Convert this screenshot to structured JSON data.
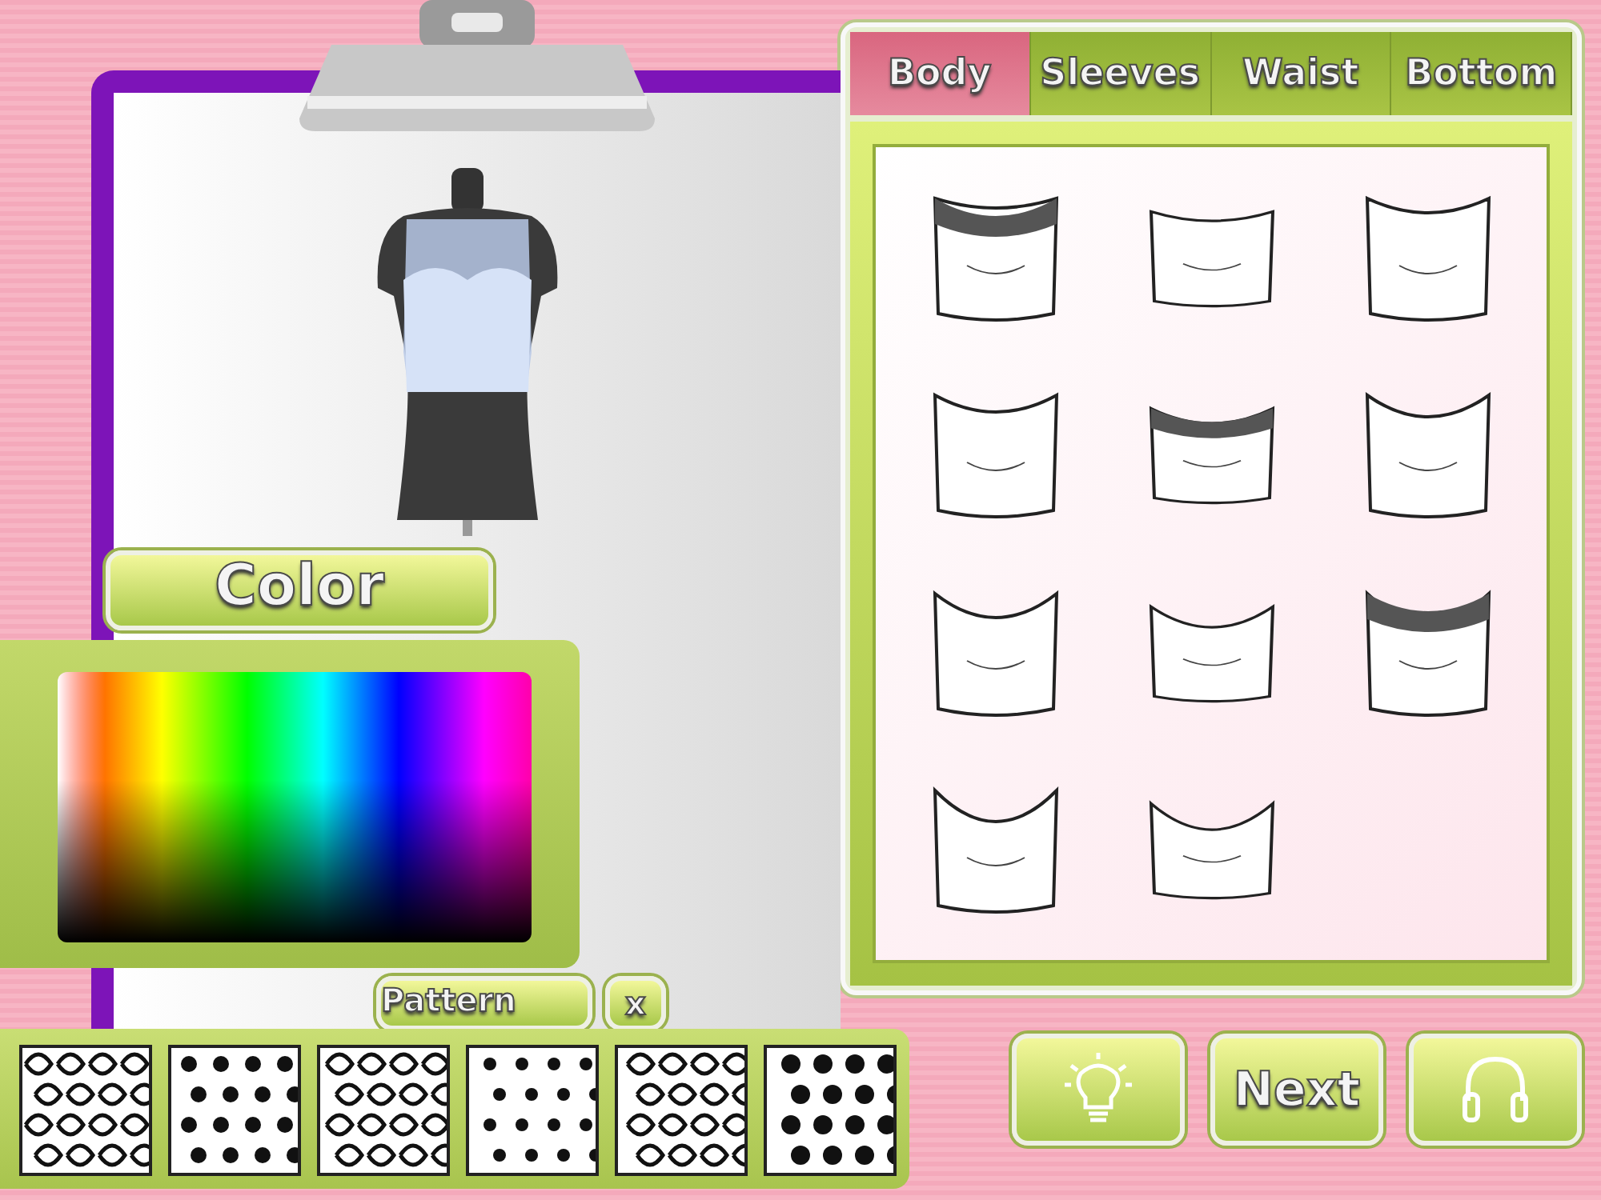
{
  "color_panel": {
    "title": "Color"
  },
  "pattern_panel": {
    "title": "Pattern",
    "close": "x"
  },
  "tabs": [
    {
      "label": "Body",
      "selected": true
    },
    {
      "label": "Sleeves",
      "selected": false
    },
    {
      "label": "Waist",
      "selected": false
    },
    {
      "label": "Bottom",
      "selected": false
    }
  ],
  "buttons": [
    {
      "kind": "hint"
    },
    {
      "kind": "text",
      "label": "Next"
    },
    {
      "kind": "sound"
    }
  ]
}
